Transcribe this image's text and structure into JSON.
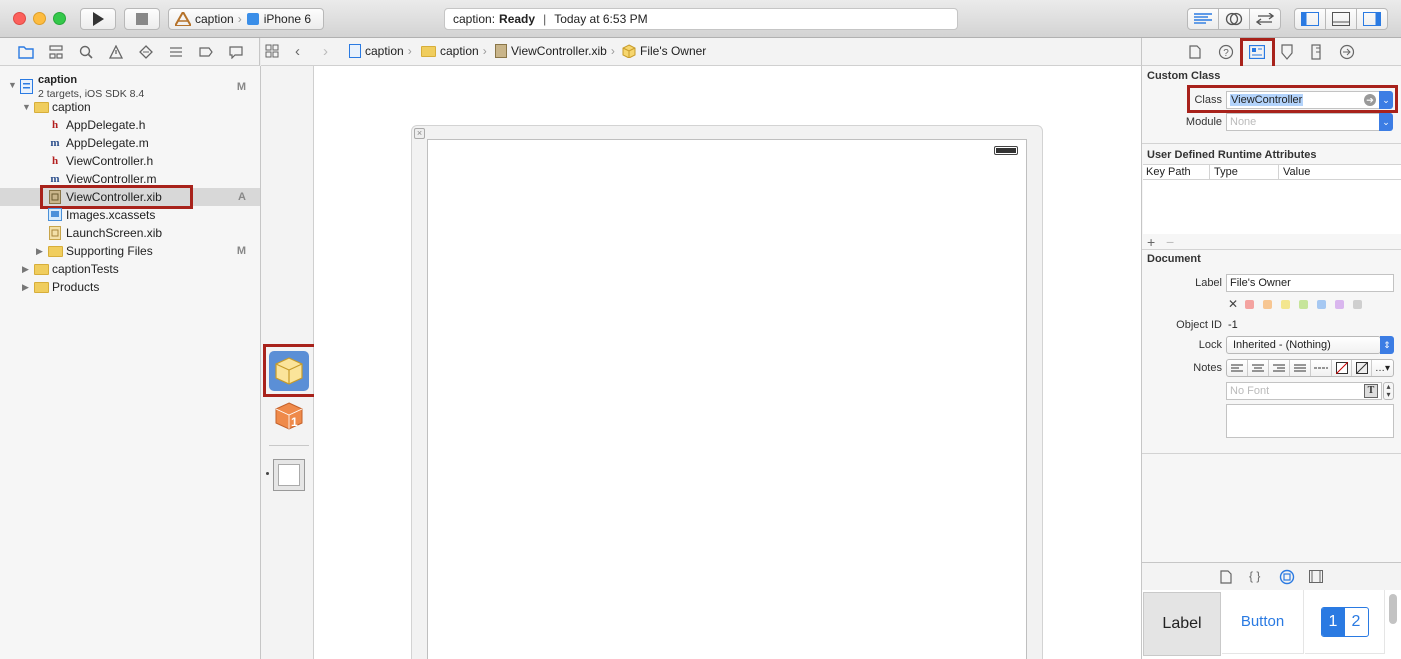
{
  "toolbar": {
    "scheme_project": "caption",
    "scheme_device": "iPhone 6",
    "status_project": "caption:",
    "status_state": "Ready",
    "status_time": "Today at 6:53 PM"
  },
  "navigator": {
    "project": {
      "name": "caption",
      "subtitle": "2 targets, iOS SDK 8.4",
      "badge": "M"
    },
    "items": [
      {
        "label": "caption",
        "type": "folder",
        "badge": ""
      },
      {
        "label": "AppDelegate.h",
        "type": "h",
        "badge": ""
      },
      {
        "label": "AppDelegate.m",
        "type": "m",
        "badge": ""
      },
      {
        "label": "ViewController.h",
        "type": "h",
        "badge": ""
      },
      {
        "label": "ViewController.m",
        "type": "m",
        "badge": ""
      },
      {
        "label": "ViewController.xib",
        "type": "xib",
        "badge": "A"
      },
      {
        "label": "Images.xcassets",
        "type": "assets",
        "badge": ""
      },
      {
        "label": "LaunchScreen.xib",
        "type": "xib",
        "badge": ""
      },
      {
        "label": "Supporting Files",
        "type": "folder",
        "badge": "M"
      },
      {
        "label": "captionTests",
        "type": "folder",
        "badge": ""
      },
      {
        "label": "Products",
        "type": "folder",
        "badge": ""
      }
    ]
  },
  "jumpbar": {
    "crumbs": [
      "caption",
      "caption",
      "ViewController.xib",
      "File's Owner"
    ]
  },
  "inspector": {
    "custom_class": {
      "title": "Custom Class",
      "class_label": "Class",
      "class_value": "ViewController",
      "module_label": "Module",
      "module_placeholder": "None"
    },
    "runtime_attributes": {
      "title": "User Defined Runtime Attributes",
      "columns": [
        "Key Path",
        "Type",
        "Value"
      ],
      "add": "+",
      "remove": "−"
    },
    "document": {
      "title": "Document",
      "label_label": "Label",
      "label_value": "File's Owner",
      "object_id_label": "Object ID",
      "object_id_value": "-1",
      "lock_label": "Lock",
      "lock_value": "Inherited - (Nothing)",
      "notes_label": "Notes",
      "font_placeholder": "No Font",
      "swatch_colors": [
        "#f4a3a0",
        "#f7c692",
        "#f3e68f",
        "#c6e59a",
        "#a6c8f2",
        "#d9b6ee",
        "#cfcfcf"
      ]
    }
  },
  "library": {
    "label_cell": "Label",
    "button_cell": "Button",
    "seg_1": "1",
    "seg_2": "2"
  },
  "colors": {
    "highlight": "#a8221b",
    "accent": "#2a7ae2"
  }
}
